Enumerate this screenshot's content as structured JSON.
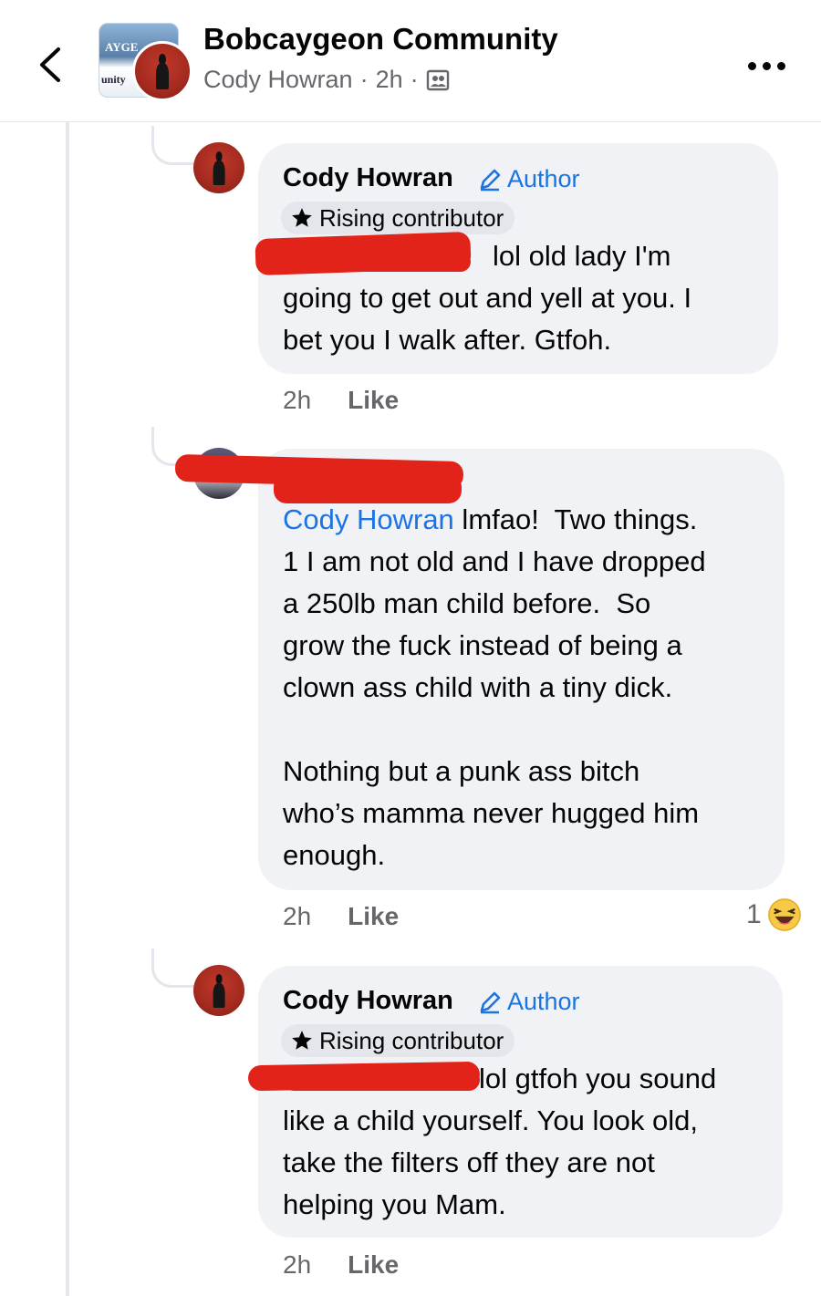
{
  "header": {
    "group_name": "Bobcaygeon Community",
    "poster_name": "Cody Howran",
    "time": "2h",
    "separator": "·",
    "avatar_text_top": "AYGE",
    "avatar_text_bottom": "unity",
    "icons": {
      "back": "chevron-left-icon",
      "audience": "group-members-icon",
      "more": "more-dots-icon"
    }
  },
  "comments": [
    {
      "author": "Cody Howran",
      "badge": "Author",
      "contributor": "Rising contributor",
      "text": "lol old lady I'm\ngoing to get out and yell at you. I\nbet you I walk after. Gtfoh.",
      "time": "2h",
      "like_label": "Like",
      "redacted": true
    },
    {
      "author": "",
      "mention": "Cody Howran",
      "text_after_mention": " lmfao!  Two things.\n1 I am not old and I have dropped\na 250lb man child before.  So\ngrow the fuck instead of being a\nclown ass child with a tiny dick.\n\nNothing but a punk ass bitch\nwho’s mamma never hugged him\nenough.",
      "time": "2h",
      "like_label": "Like",
      "reaction_count": "1",
      "reaction_icon": "haha-emoji-icon",
      "redacted": true
    },
    {
      "author": "Cody Howran",
      "badge": "Author",
      "contributor": "Rising contributor",
      "text": "lol gtfoh you sound\nlike a child yourself. You look old,\ntake the filters off they are not\nhelping you Mam.",
      "time": "2h",
      "like_label": "Like",
      "redacted": true
    }
  ],
  "colors": {
    "bubble": "#f0f2f5",
    "link_blue": "#1b74e4",
    "meta_gray": "#65676b",
    "redaction": "#e2231a"
  }
}
